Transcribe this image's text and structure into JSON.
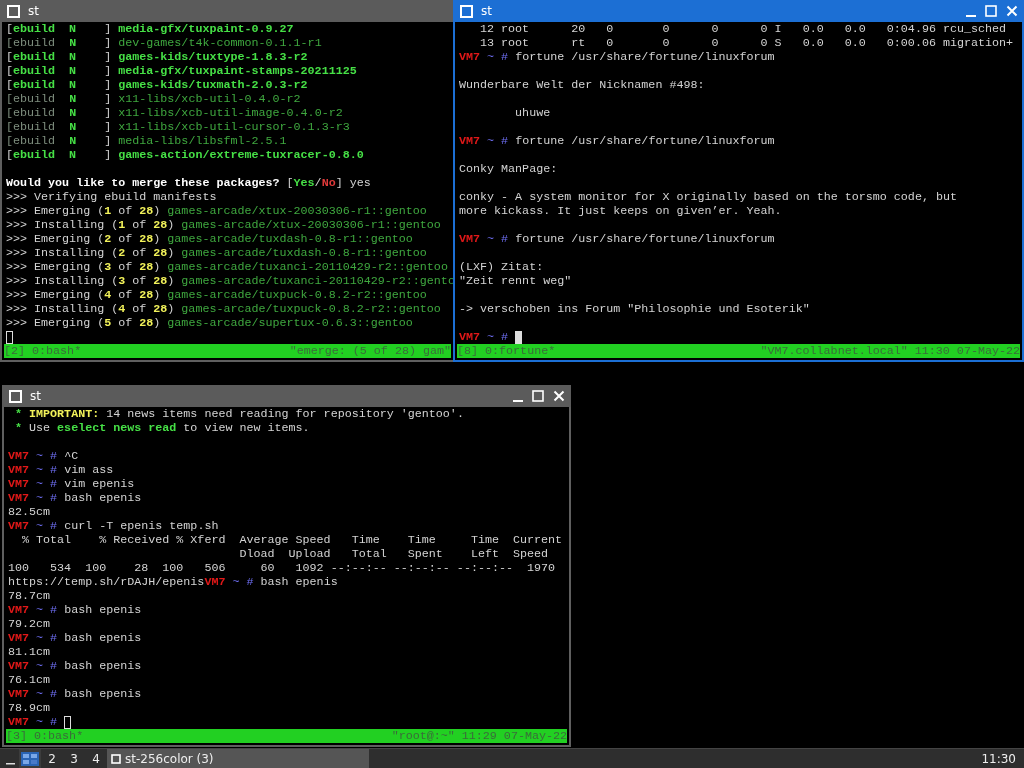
{
  "windows": [
    {
      "title": "st",
      "active": false,
      "has_controls": false,
      "lines": [
        {
          "kind": "text",
          "segments": [
            {
              "text": "[",
              "kind": "plain"
            },
            {
              "text": "ebuild  N",
              "kind": "green-bold"
            },
            {
              "text": "    ] ",
              "kind": "plain"
            },
            {
              "text": "media-gfx/tuxpaint-0.9.27",
              "kind": "green-bold"
            }
          ]
        },
        {
          "kind": "text",
          "segments": [
            {
              "text": "[ebuild",
              "kind": "dim"
            },
            {
              "text": "  N",
              "kind": "green-bold"
            },
            {
              "text": "    ] ",
              "kind": "plain"
            },
            {
              "text": "dev-games/t4k-common-0.1.1-r1",
              "kind": "green"
            }
          ]
        },
        {
          "kind": "text",
          "segments": [
            {
              "text": "[",
              "kind": "plain"
            },
            {
              "text": "ebuild  N",
              "kind": "green-bold"
            },
            {
              "text": "    ] ",
              "kind": "plain"
            },
            {
              "text": "games-kids/tuxtype-1.8.3-r2",
              "kind": "green-bold"
            }
          ]
        },
        {
          "kind": "text",
          "segments": [
            {
              "text": "[",
              "kind": "plain"
            },
            {
              "text": "ebuild  N",
              "kind": "green-bold"
            },
            {
              "text": "    ] ",
              "kind": "plain"
            },
            {
              "text": "media-gfx/tuxpaint-stamps-20211125",
              "kind": "green-bold"
            }
          ]
        },
        {
          "kind": "text",
          "segments": [
            {
              "text": "[",
              "kind": "plain"
            },
            {
              "text": "ebuild  N",
              "kind": "green-bold"
            },
            {
              "text": "    ] ",
              "kind": "plain"
            },
            {
              "text": "games-kids/tuxmath-2.0.3-r2",
              "kind": "green-bold"
            }
          ]
        },
        {
          "kind": "text",
          "segments": [
            {
              "text": "[ebuild",
              "kind": "dim"
            },
            {
              "text": "  N",
              "kind": "green-bold"
            },
            {
              "text": "    ] ",
              "kind": "plain"
            },
            {
              "text": "x11-libs/xcb-util-0.4.0-r2",
              "kind": "green"
            }
          ]
        },
        {
          "kind": "text",
          "segments": [
            {
              "text": "[ebuild",
              "kind": "dim"
            },
            {
              "text": "  N",
              "kind": "green-bold"
            },
            {
              "text": "    ] ",
              "kind": "plain"
            },
            {
              "text": "x11-libs/xcb-util-image-0.4.0-r2",
              "kind": "green"
            }
          ]
        },
        {
          "kind": "text",
          "segments": [
            {
              "text": "[ebuild",
              "kind": "dim"
            },
            {
              "text": "  N",
              "kind": "green-bold"
            },
            {
              "text": "    ] ",
              "kind": "plain"
            },
            {
              "text": "x11-libs/xcb-util-cursor-0.1.3-r3",
              "kind": "green"
            }
          ]
        },
        {
          "kind": "text",
          "segments": [
            {
              "text": "[ebuild",
              "kind": "dim"
            },
            {
              "text": "  N",
              "kind": "green-bold"
            },
            {
              "text": "    ] ",
              "kind": "plain"
            },
            {
              "text": "media-libs/libsfml-2.5.1",
              "kind": "green"
            }
          ]
        },
        {
          "kind": "text",
          "segments": [
            {
              "text": "[",
              "kind": "plain"
            },
            {
              "text": "ebuild  N",
              "kind": "green-bold"
            },
            {
              "text": "    ] ",
              "kind": "plain"
            },
            {
              "text": "games-action/extreme-tuxracer-0.8.0",
              "kind": "green-bold"
            }
          ]
        },
        {
          "kind": "blank"
        },
        {
          "kind": "text",
          "segments": [
            {
              "text": "Would you like to merge these packages? ",
              "kind": "bold"
            },
            {
              "text": "[",
              "kind": "plain"
            },
            {
              "text": "Yes",
              "kind": "green-bold"
            },
            {
              "text": "/",
              "kind": "plain"
            },
            {
              "text": "No",
              "kind": "red-bold"
            },
            {
              "text": "] yes",
              "kind": "plain"
            }
          ]
        },
        {
          "kind": "text",
          "segments": [
            {
              "text": ">>> Verifying ebuild manifests",
              "kind": "plain"
            }
          ]
        },
        {
          "kind": "text",
          "segments": [
            {
              "text": ">>> Emerging (",
              "kind": "plain"
            },
            {
              "text": "1",
              "kind": "yellow-bold"
            },
            {
              "text": " of ",
              "kind": "plain"
            },
            {
              "text": "28",
              "kind": "yellow-bold"
            },
            {
              "text": ") ",
              "kind": "plain"
            },
            {
              "text": "games-arcade/xtux-20030306-r1::gentoo",
              "kind": "green"
            }
          ]
        },
        {
          "kind": "text",
          "segments": [
            {
              "text": ">>> Installing (",
              "kind": "plain"
            },
            {
              "text": "1",
              "kind": "yellow-bold"
            },
            {
              "text": " of ",
              "kind": "plain"
            },
            {
              "text": "28",
              "kind": "yellow-bold"
            },
            {
              "text": ") ",
              "kind": "plain"
            },
            {
              "text": "games-arcade/xtux-20030306-r1::gentoo",
              "kind": "green"
            }
          ]
        },
        {
          "kind": "text",
          "segments": [
            {
              "text": ">>> Emerging (",
              "kind": "plain"
            },
            {
              "text": "2",
              "kind": "yellow-bold"
            },
            {
              "text": " of ",
              "kind": "plain"
            },
            {
              "text": "28",
              "kind": "yellow-bold"
            },
            {
              "text": ") ",
              "kind": "plain"
            },
            {
              "text": "games-arcade/tuxdash-0.8-r1::gentoo",
              "kind": "green"
            }
          ]
        },
        {
          "kind": "text",
          "segments": [
            {
              "text": ">>> Installing (",
              "kind": "plain"
            },
            {
              "text": "2",
              "kind": "yellow-bold"
            },
            {
              "text": " of ",
              "kind": "plain"
            },
            {
              "text": "28",
              "kind": "yellow-bold"
            },
            {
              "text": ") ",
              "kind": "plain"
            },
            {
              "text": "games-arcade/tuxdash-0.8-r1::gentoo",
              "kind": "green"
            }
          ]
        },
        {
          "kind": "text",
          "segments": [
            {
              "text": ">>> Emerging (",
              "kind": "plain"
            },
            {
              "text": "3",
              "kind": "yellow-bold"
            },
            {
              "text": " of ",
              "kind": "plain"
            },
            {
              "text": "28",
              "kind": "yellow-bold"
            },
            {
              "text": ") ",
              "kind": "plain"
            },
            {
              "text": "games-arcade/tuxanci-20110429-r2::gentoo",
              "kind": "green"
            }
          ]
        },
        {
          "kind": "text",
          "segments": [
            {
              "text": ">>> Installing (",
              "kind": "plain"
            },
            {
              "text": "3",
              "kind": "yellow-bold"
            },
            {
              "text": " of ",
              "kind": "plain"
            },
            {
              "text": "28",
              "kind": "yellow-bold"
            },
            {
              "text": ") ",
              "kind": "plain"
            },
            {
              "text": "games-arcade/tuxanci-20110429-r2::gento",
              "kind": "green"
            }
          ]
        },
        {
          "kind": "text",
          "segments": [
            {
              "text": ">>> Emerging (",
              "kind": "plain"
            },
            {
              "text": "4",
              "kind": "yellow-bold"
            },
            {
              "text": " of ",
              "kind": "plain"
            },
            {
              "text": "28",
              "kind": "yellow-bold"
            },
            {
              "text": ") ",
              "kind": "plain"
            },
            {
              "text": "games-arcade/tuxpuck-0.8.2-r2::gentoo",
              "kind": "green"
            }
          ]
        },
        {
          "kind": "text",
          "segments": [
            {
              "text": ">>> Installing (",
              "kind": "plain"
            },
            {
              "text": "4",
              "kind": "yellow-bold"
            },
            {
              "text": " of ",
              "kind": "plain"
            },
            {
              "text": "28",
              "kind": "yellow-bold"
            },
            {
              "text": ") ",
              "kind": "plain"
            },
            {
              "text": "games-arcade/tuxpuck-0.8.2-r2::gentoo",
              "kind": "green"
            }
          ]
        },
        {
          "kind": "text",
          "segments": [
            {
              "text": ">>> Emerging (",
              "kind": "plain"
            },
            {
              "text": "5",
              "kind": "yellow-bold"
            },
            {
              "text": " of ",
              "kind": "plain"
            },
            {
              "text": "28",
              "kind": "yellow-bold"
            },
            {
              "text": ") ",
              "kind": "plain"
            },
            {
              "text": "games-arcade/supertux-0.6.3::gentoo",
              "kind": "green"
            }
          ]
        },
        {
          "kind": "cursor",
          "cursor": true
        }
      ],
      "status": {
        "left": "[2] 0:bash*",
        "right": "\"emerge: (5 of 28) gam\""
      }
    },
    {
      "title": "st",
      "active": true,
      "has_controls": true,
      "lines": [
        {
          "kind": "text",
          "segments": [
            {
              "text": "   12 root      20   0       0      0      0 I   0.0   0.0   0:04.96 rcu_sched",
              "kind": "plain"
            }
          ]
        },
        {
          "kind": "text",
          "segments": [
            {
              "text": "   13 root      rt   0       0      0      0 S   0.0   0.0   0:00.06 migration+",
              "kind": "plain"
            }
          ]
        },
        {
          "kind": "text",
          "segments": [
            {
              "text": "VM7",
              "kind": "host"
            },
            {
              "text": " ~ # ",
              "kind": "prompt"
            },
            {
              "text": "fortune /usr/share/fortune/linuxforum",
              "kind": "plain"
            }
          ]
        },
        {
          "kind": "blank"
        },
        {
          "kind": "text",
          "segments": [
            {
              "text": "Wunderbare Welt der Nicknamen #498:",
              "kind": "plain"
            }
          ]
        },
        {
          "kind": "blank"
        },
        {
          "kind": "text",
          "segments": [
            {
              "text": "        uhuwe",
              "kind": "plain"
            }
          ]
        },
        {
          "kind": "blank"
        },
        {
          "kind": "text",
          "segments": [
            {
              "text": "VM7",
              "kind": "host"
            },
            {
              "text": " ~ # ",
              "kind": "prompt"
            },
            {
              "text": "fortune /usr/share/fortune/linuxforum",
              "kind": "plain"
            }
          ]
        },
        {
          "kind": "blank"
        },
        {
          "kind": "text",
          "segments": [
            {
              "text": "Conky ManPage:",
              "kind": "plain"
            }
          ]
        },
        {
          "kind": "blank"
        },
        {
          "kind": "text",
          "segments": [
            {
              "text": "conky - A system monitor for X originally based on the torsmo code, but",
              "kind": "plain"
            }
          ]
        },
        {
          "kind": "text",
          "segments": [
            {
              "text": "more kickass. It just keeps on given’er. Yeah.",
              "kind": "plain"
            }
          ]
        },
        {
          "kind": "blank"
        },
        {
          "kind": "text",
          "segments": [
            {
              "text": "VM7",
              "kind": "host"
            },
            {
              "text": " ~ # ",
              "kind": "prompt"
            },
            {
              "text": "fortune /usr/share/fortune/linuxforum",
              "kind": "plain"
            }
          ]
        },
        {
          "kind": "blank"
        },
        {
          "kind": "text",
          "segments": [
            {
              "text": "(LXF) Zitat:",
              "kind": "plain"
            }
          ]
        },
        {
          "kind": "text",
          "segments": [
            {
              "text": "\"Zeit rennt weg\"",
              "kind": "plain"
            }
          ]
        },
        {
          "kind": "blank"
        },
        {
          "kind": "text",
          "segments": [
            {
              "text": "-> verschoben ins Forum \"Philosophie und Esoterik\"",
              "kind": "plain"
            }
          ]
        },
        {
          "kind": "blank"
        },
        {
          "kind": "text",
          "segments": [
            {
              "text": "VM7",
              "kind": "host"
            },
            {
              "text": " ~ #",
              "kind": "prompt"
            }
          ],
          "cursor": true
        }
      ],
      "status": {
        "left": "[8] 0:fortune*",
        "right": "\"VM7.collabnet.local\" 11:30 07-May-22"
      }
    },
    {
      "title": "st",
      "active": false,
      "has_controls": true,
      "lines": [
        {
          "kind": "text",
          "segments": [
            {
              "text": " * ",
              "kind": "green-bold"
            },
            {
              "text": "IMPORTANT:",
              "kind": "yellow-bold"
            },
            {
              "text": " 14 news items need reading for repository 'gentoo'.",
              "kind": "plain"
            }
          ]
        },
        {
          "kind": "text",
          "segments": [
            {
              "text": " * ",
              "kind": "green-bold"
            },
            {
              "text": "Use ",
              "kind": "plain"
            },
            {
              "text": "eselect news read",
              "kind": "green-bold"
            },
            {
              "text": " to view new items.",
              "kind": "plain"
            }
          ]
        },
        {
          "kind": "blank"
        },
        {
          "kind": "text",
          "segments": [
            {
              "text": "VM7",
              "kind": "host"
            },
            {
              "text": " ~ # ",
              "kind": "prompt"
            },
            {
              "text": "^C",
              "kind": "plain"
            }
          ]
        },
        {
          "kind": "text",
          "segments": [
            {
              "text": "VM7",
              "kind": "host"
            },
            {
              "text": " ~ # ",
              "kind": "prompt"
            },
            {
              "text": "vim ass",
              "kind": "plain"
            }
          ]
        },
        {
          "kind": "text",
          "segments": [
            {
              "text": "VM7",
              "kind": "host"
            },
            {
              "text": " ~ # ",
              "kind": "prompt"
            },
            {
              "text": "vim epenis",
              "kind": "plain"
            }
          ]
        },
        {
          "kind": "text",
          "segments": [
            {
              "text": "VM7",
              "kind": "host"
            },
            {
              "text": " ~ # ",
              "kind": "prompt"
            },
            {
              "text": "bash epenis",
              "kind": "plain"
            }
          ]
        },
        {
          "kind": "text",
          "segments": [
            {
              "text": "82.5cm",
              "kind": "plain"
            }
          ]
        },
        {
          "kind": "text",
          "segments": [
            {
              "text": "VM7",
              "kind": "host"
            },
            {
              "text": " ~ # ",
              "kind": "prompt"
            },
            {
              "text": "curl -T epenis temp.sh",
              "kind": "plain"
            }
          ]
        },
        {
          "kind": "text",
          "segments": [
            {
              "text": "  % Total    % Received % Xferd  Average Speed   Time    Time     Time  Current",
              "kind": "plain"
            }
          ]
        },
        {
          "kind": "text",
          "segments": [
            {
              "text": "                                 Dload  Upload   Total   Spent    Left  Speed",
              "kind": "plain"
            }
          ]
        },
        {
          "kind": "text",
          "segments": [
            {
              "text": "100   534  100    28  100   506     60   1092 --:--:-- --:--:-- --:--:--  1970",
              "kind": "plain"
            }
          ]
        },
        {
          "kind": "text",
          "segments": [
            {
              "text": "https://temp.sh/rDAJH/epenis",
              "kind": "plain"
            },
            {
              "text": "VM7",
              "kind": "host"
            },
            {
              "text": " ~ # ",
              "kind": "prompt"
            },
            {
              "text": "bash epenis",
              "kind": "plain"
            }
          ]
        },
        {
          "kind": "text",
          "segments": [
            {
              "text": "78.7cm",
              "kind": "plain"
            }
          ]
        },
        {
          "kind": "text",
          "segments": [
            {
              "text": "VM7",
              "kind": "host"
            },
            {
              "text": " ~ # ",
              "kind": "prompt"
            },
            {
              "text": "bash epenis",
              "kind": "plain"
            }
          ]
        },
        {
          "kind": "text",
          "segments": [
            {
              "text": "79.2cm",
              "kind": "plain"
            }
          ]
        },
        {
          "kind": "text",
          "segments": [
            {
              "text": "VM7",
              "kind": "host"
            },
            {
              "text": " ~ # ",
              "kind": "prompt"
            },
            {
              "text": "bash epenis",
              "kind": "plain"
            }
          ]
        },
        {
          "kind": "text",
          "segments": [
            {
              "text": "81.1cm",
              "kind": "plain"
            }
          ]
        },
        {
          "kind": "text",
          "segments": [
            {
              "text": "VM7",
              "kind": "host"
            },
            {
              "text": " ~ # ",
              "kind": "prompt"
            },
            {
              "text": "bash epenis",
              "kind": "plain"
            }
          ]
        },
        {
          "kind": "text",
          "segments": [
            {
              "text": "76.1cm",
              "kind": "plain"
            }
          ]
        },
        {
          "kind": "text",
          "segments": [
            {
              "text": "VM7",
              "kind": "host"
            },
            {
              "text": " ~ # ",
              "kind": "prompt"
            },
            {
              "text": "bash epenis",
              "kind": "plain"
            }
          ]
        },
        {
          "kind": "text",
          "segments": [
            {
              "text": "78.9cm",
              "kind": "plain"
            }
          ]
        },
        {
          "kind": "text",
          "segments": [
            {
              "text": "VM7",
              "kind": "host"
            },
            {
              "text": " ~ #",
              "kind": "prompt"
            }
          ],
          "cursor": true
        }
      ],
      "status": {
        "left": "[3] 0:bash*",
        "right": "\"root@:~\" 11:29 07-May-22"
      }
    }
  ],
  "taskbar": {
    "desktops": [
      {
        "selected": true
      },
      {
        "label": "2",
        "selected": false
      },
      {
        "label": "3",
        "selected": false
      },
      {
        "label": "4",
        "selected": false
      }
    ],
    "tasks": [
      {
        "label": "st-256color (3)",
        "selected": true
      }
    ],
    "clock": "11:30"
  }
}
